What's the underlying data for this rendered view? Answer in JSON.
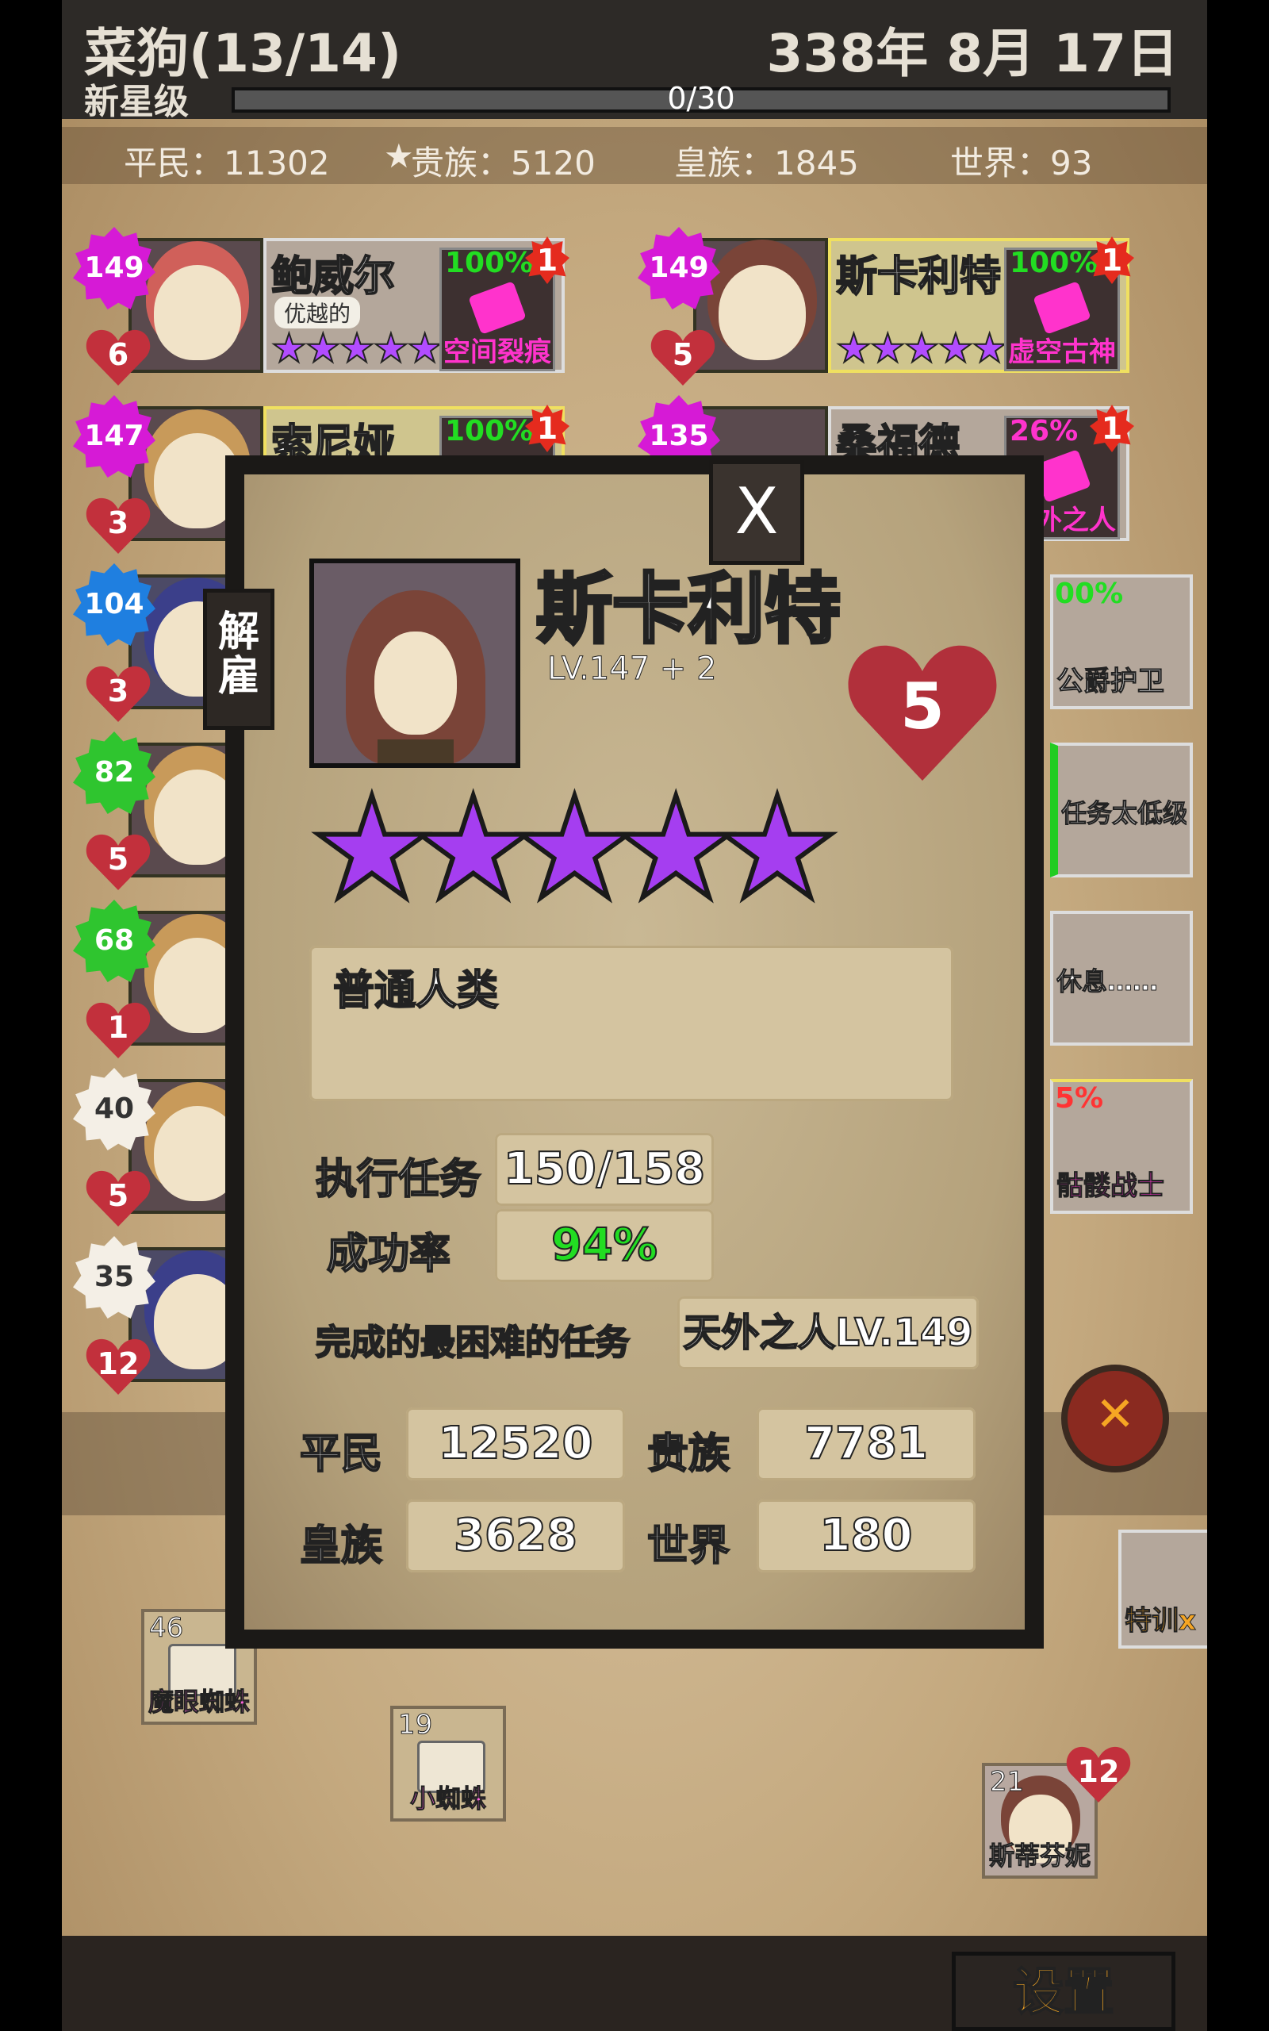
{
  "header": {
    "title": "菜狗(13/14)",
    "date": "338年 8月 17日",
    "rank": "新星级",
    "xp": "0/30",
    "xp_fraction": 0
  },
  "stats": {
    "commoner": "平民：11302",
    "noble": "贵族：5120",
    "royal": "皇族：1845",
    "world": "世界：93"
  },
  "roster": [
    {
      "level": "149",
      "level_color": "#d61ad6",
      "affinity": "6",
      "name": "鲍威尔",
      "trait": "优越的",
      "stars": "★★★★★",
      "quest_pct": "100%",
      "quest": "空间裂痕",
      "badge": "1"
    },
    {
      "level": "149",
      "level_color": "#d61ad6",
      "affinity": "5",
      "name": "斯卡利特",
      "stars": "★★★★★",
      "quest_pct": "100%",
      "quest": "虚空古神",
      "badge": "1"
    },
    {
      "level": "147",
      "level_color": "#d61ad6",
      "affinity": "3",
      "name": "索尼娅",
      "quest_pct": "100%",
      "badge": "1"
    },
    {
      "level": "135",
      "level_color": "#d61ad6",
      "name": "桑福德",
      "quest_pct": "26%",
      "quest": "天外之人",
      "badge": "1"
    },
    {
      "level": "104",
      "level_color": "#1f7fe0",
      "affinity": "3"
    },
    {
      "level": "82",
      "level_color": "#2fc52f",
      "affinity": "5"
    },
    {
      "level": "68",
      "level_color": "#2fc52f",
      "affinity": "1"
    },
    {
      "level": "40",
      "level_color": "#f4efe6",
      "affinity": "5"
    },
    {
      "level": "35",
      "level_color": "#f4efe6",
      "affinity": "12"
    }
  ],
  "right_column": [
    {
      "pct": "00%",
      "quest": "公爵护卫"
    },
    {
      "quest": "任务太低级"
    },
    {
      "quest": "休息……"
    },
    {
      "pct": "5%",
      "quest": "骷髅战士"
    }
  ],
  "modal": {
    "close": "X",
    "dismiss": "解雇",
    "name": "斯卡利特",
    "level": "LV.147 + 2",
    "affinity": "5",
    "stars": "★★★★★",
    "description": "普通人类",
    "missions_label": "执行任务",
    "missions_value": "150/158",
    "success_label": "成功率",
    "success_value": "94%",
    "hardest_label": "完成的最困难的任务",
    "hardest_value": "天外之人LV.149",
    "commoner_label": "平民",
    "commoner_value": "12520",
    "noble_label": "贵族",
    "noble_value": "7781",
    "royal_label": "皇族",
    "royal_value": "3628",
    "world_label": "世界",
    "world_value": "180"
  },
  "quests_board": [
    {
      "count": "46",
      "name": "魔眼蜘蛛"
    },
    {
      "count": "19",
      "name": "小蜘蛛"
    }
  ],
  "recruit": {
    "count": "21",
    "affinity": "12",
    "name": "斯蒂芬妮"
  },
  "training": "特训x",
  "settings_label": "设置",
  "colors": {
    "success_green": "#22dd22",
    "star_purple": "#a53ef0",
    "quest_pink": "#ff33cc",
    "heart_red": "#c2303c"
  }
}
